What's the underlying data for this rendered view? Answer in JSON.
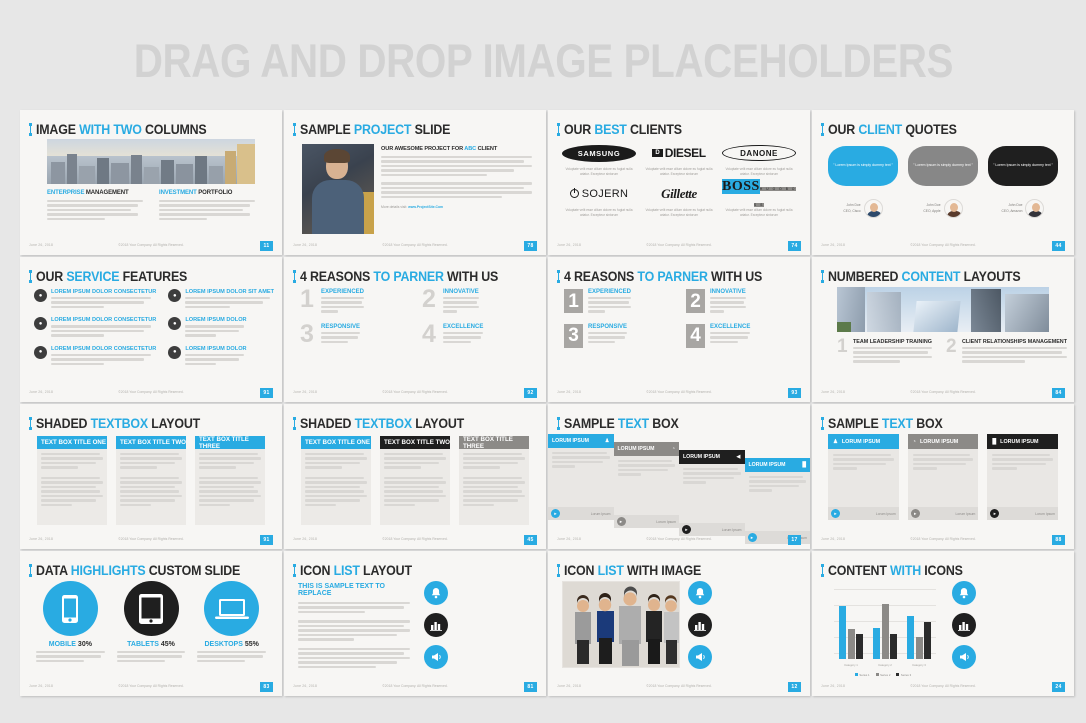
{
  "banner": {
    "title": "DRAG AND DROP IMAGE PLACEHOLDERS"
  },
  "common": {
    "date": "June 26, 2018",
    "copyright": "©2018 Your Company. All Rights Reserved.",
    "lorem_short": "Lorem ipsum dolor sit amet, consectetuer adipiscing elit, sed diam nonummy nibh euismod tincidunt ut laoreet dolore.",
    "lorem_long": "There are many variations of passages of Lorem Ipsum available, but the majority have suffered alteration.",
    "client_caption": "Voluptate velit esse cillum dolore eu fugiat nulla ariatur. Excepteur sintorum"
  },
  "slides": [
    {
      "num": "11",
      "title": {
        "pre": "IMAGE ",
        "hl": "WITH TWO",
        "post": " COLUMNS"
      },
      "columns": [
        {
          "head_hl": "ENTERPRISE",
          "head_rest": " MANAGEMENT",
          "body": "Lorem ipsum dolor sit amet, consectetuer adipiscing elit, sed dia nonummy nibh euismod tincidunt ut laoreet dolore. Rhoncus ut, imperdiet a, venenatis vitae. There are many variations of passages of Lorem Ipsum available, but the majority have suffered alteration."
        },
        {
          "head_hl": "INVESTMENT",
          "head_rest": " PORTFOLIO",
          "body": "Lorem ipsum dolor sit amet, consectetuer adipiscing elit, sed dia nonummy nibh euismod tincidunt ut laoreet dolore. Rhoncus ut, imperdiet a, venenatis vitae. There are many variations of passages of Lorem Ipsum available, but the majority have suffered alteration."
        }
      ],
      "image_alt": "cityscape-photo"
    },
    {
      "num": "78",
      "title": {
        "pre": "SAMPLE ",
        "hl": "PROJECT",
        "post": " SLIDE"
      },
      "heading_pre": "OUR AWESOME PROJECT FOR ",
      "heading_hl": "ABC",
      "heading_post": " CLIENT",
      "para1": "Lorem ipsum dolor sit amet, consectetuer adipiscing elit. Aenean commodo ligula eget dolor. Aenean massa. Cum sociis natoque penatibus. Ultricies pellentesque eu, pretium quis, sem. Nulla consequat massa quis enim. Donec pede justo, fringilla vel, aliquet nec, vulputate eget, arcu. In enim justo, Rhoncus ut, imperdiet a, venenatis vitae, justo.",
      "para2": "Nullam dictum felis eu pede mollis pretium Lorem ipsum dolor sit amet, consectetuer adipiscing elit, sed dia nonummy nibh euismod tincidunt ut laoreet dolore. Rhoncus ut, imperdiet a, venenatis vitae. There are many variations of passages of Lorem Ipsum available, but the majority have suffered alteration.",
      "more_label": "More details visit: ",
      "more_link": "www.ProjectSite.Com",
      "image_alt": "man-portrait-photo"
    },
    {
      "num": "74",
      "title": {
        "pre": "OUR ",
        "hl": "BEST",
        "post": " CLIENTS"
      },
      "clients": [
        {
          "name": "SAMSUNG",
          "style": "samsung"
        },
        {
          "name": "DIESEL",
          "style": "diesel"
        },
        {
          "name": "DANONE",
          "style": "danone"
        },
        {
          "name": "SOJERN",
          "style": "sojern"
        },
        {
          "name": "Gillette",
          "style": "gillette"
        },
        {
          "name": "BOSS",
          "sub": "H U G O  B O S S",
          "style": "boss"
        }
      ]
    },
    {
      "num": "44",
      "title": {
        "pre": "OUR ",
        "hl": "CLIENT",
        "post": " QUOTES"
      },
      "quotes": [
        {
          "text": "\" Lorem Ipsum is simply dummy text \"",
          "color": "blue",
          "name": "John Doe",
          "role": "CEO, Cisco"
        },
        {
          "text": "\" Lorem Ipsum is simply dummy text \"",
          "color": "gray",
          "name": "John Doe",
          "role": "CEO, Apple"
        },
        {
          "text": "\" Lorem Ipsum is simply dummy text \"",
          "color": "dark",
          "name": "John Doe",
          "role": "CEO, Amazon"
        }
      ]
    },
    {
      "num": "91",
      "title": {
        "pre": "OUR ",
        "hl": "SERVICE",
        "post": " FEATURES"
      },
      "features": [
        {
          "head": "LOREM IPSUM DOLOR CONSECTETUR",
          "icon": "chat-icon",
          "glyph": "✉",
          "body": "Sed do eiusmod tempor incididunt ut labore dolore magna aliqua. Ut enimue ad minim veniam, quis nostrud exercitation."
        },
        {
          "head": "LOREM IPSUM DOLOR SIT AMET",
          "icon": "mail-icon",
          "glyph": "✉",
          "body": "Sed do eiusmod tempor incididunt ut labore dolore magna aliqua. Ut enimue ad minim veniam, quis nostrud exercitation."
        },
        {
          "head": "LOREM IPSUM DOLOR CONSECTETUR",
          "icon": "phone-icon",
          "glyph": "☎",
          "body": "Sed do eiusmod tempor incididunt ut labore dolore magna aliqua. Ut enimue ad minim veniam, quis nostrud exercitation."
        },
        {
          "head": "LOREM IPSUM DOLOR",
          "icon": "pencil-icon",
          "glyph": "✎",
          "body": "Sed do eiusmod tempor incididunt ut labore dolore magna aliqua. Ut enimue ad minim veniam, quis nostrud exercitation."
        },
        {
          "head": "LOREM IPSUM DOLOR CONSECTETUR",
          "icon": "heart-icon",
          "glyph": "♥",
          "body": "Sed do eiusmod tempor incididunt ut labore dolore magna aliqua. Ut enimue ad minim veniam, quis nostrud exercitation."
        },
        {
          "head": "LOREM IPSUM DOLOR",
          "icon": "pencil-icon",
          "glyph": "✎",
          "body": "Sed do eiusmod tempor incididunt ut labore dolore magna aliqua. Ut enimue ad minim veniam, quis nostrud exercitation."
        }
      ]
    },
    {
      "num": "92",
      "title": {
        "pre": "4 REASONS ",
        "hl": "TO PARNER",
        "post": " WITH US"
      },
      "reasons": [
        {
          "n": "1",
          "head": "EXPERIENCED",
          "body": "There are many variations of passages of Lorem Ipsum available, but the majority have suffered alteration in some form, by injected humour, or randomised words which don't look even slightly believable."
        },
        {
          "n": "2",
          "head": "INNOVATIVE",
          "body": "There are many variations of passages of Lorem Ipsum available, but the majority have suffered alteration in some form, by injected humour, or randomised words which don't look even slightly believable."
        },
        {
          "n": "3",
          "head": "RESPONSIVE",
          "body": "There are many variations of passages of Lorem Ipsum available, but the majority have suffered alteration in some form, by injected humour, or randomised words."
        },
        {
          "n": "4",
          "head": "EXCELLENCE",
          "body": "There are many variations of passages of Lorem Ipsum available, but the majority have suffered alteration in some form, by injected humour, or randomised words."
        }
      ]
    },
    {
      "num": "93",
      "title": {
        "pre": "4 REASONS ",
        "hl": "TO PARNER",
        "post": " WITH US"
      },
      "reasons": [
        {
          "n": "1",
          "head": "EXPERIENCED",
          "body": "There are many variations of passages of Lorem Ipsum available, but the majority have suffered alteration in some form, by injected humour, or randomised words which don't look even slightly believable."
        },
        {
          "n": "2",
          "head": "INNOVATIVE",
          "body": "There are many variations of passages of Lorem Ipsum available, but the majority have suffered alteration in some form, by injected humour, or randomised words which don't look even slightly believable."
        },
        {
          "n": "3",
          "head": "RESPONSIVE",
          "body": "There are many variations of passages of Lorem Ipsum available, but the majority have suffered alteration in some form, by injected humour, or randomised words which."
        },
        {
          "n": "4",
          "head": "EXCELLENCE",
          "body": "There are many variations of passages of Lorem Ipsum available, but the majority have suffered alteration in some form, by injected humour, or randomised words which."
        }
      ]
    },
    {
      "num": "84",
      "title": {
        "pre": "NUMBERED ",
        "hl": "CONTENT",
        "post": " LAYOUTS"
      },
      "image_alt": "skyscrapers-photo",
      "items": [
        {
          "n": "1",
          "head": "TEAM LEADERSHIP TRAINING",
          "body": "Lorem ipsum dolor sit amet, consectetuer adipiscing elit, sed dia nonummy lorum nibh euismod tincidunt ut laoreet dolore magn. There are many variations of passages."
        },
        {
          "n": "2",
          "head": "CLIENT RELATIONSHIPS MANAGEMENT",
          "body": "Lorem ipsum dolor sit amet, consectetuer adipiscing elit, sed dia nonummy lorum nibh euismod tincidunt ut laoreet dolore magn. There are many variations of passages."
        }
      ]
    },
    {
      "num": "91",
      "title": {
        "pre": "SHADED ",
        "hl": "TEXTBOX",
        "post": " LAYOUT"
      },
      "boxes": [
        {
          "head": "TEXT BOX TITLE ONE",
          "color": "blue",
          "p1": "Lorem ipsum dolor sit amep consectetuer adipiscing elit and diam nonummy lorum nibher consectetuer adipiscing",
          "p2": "Lorem ipsum dolor sit amep consectetuer adipiscing elit sed diam nonummy lorum ipsum ober consectetuer adipiscing . There are many variations of passages of Lorem Ipsum available, but the majority have suffered"
        },
        {
          "head": "TEXT BOX TITLE TWO",
          "color": "blue",
          "p1": "Lorem ipsum dolor sit amep consectetuer adipiscing elit and diam nonummy lorum nibher consectetuer adipiscing",
          "p2": "Lorem ipsum dolor sit amep consectetuer adipiscing elit sed diam nonummy lorum ipsum ober consectetuer adipiscing . There are many variations of passages of Lorem Ipsum available, but the majority have suffered"
        },
        {
          "head": "TEXT BOX TITLE THREE",
          "color": "blue",
          "p1": "Lorem ipsum dolor sit amep consectetuer adipiscing elit and diam nonummy lorum nibher consectetuer adipiscing",
          "p2": "Lorem ipsum dolor sit amep consectetuer adipiscing elit sed diam nonummy lorum ipsum ober consectetuer adipiscing . There are many variations of passages of Lorem Ipsum available, but the majority have suffered"
        }
      ]
    },
    {
      "num": "45",
      "title": {
        "pre": "SHADED ",
        "hl": "TEXTBOX",
        "post": " LAYOUT"
      },
      "boxes": [
        {
          "head": "TEXT BOX TITLE ONE",
          "color": "blue",
          "p1": "Lorem ipsum dolor sit amep consectetuer adipiscing elit sed diam nonummy lorum nibher consectetuer adipiscing",
          "p2": "Lorem ipsum dolor sit amep consectetuer adipiscing elit sed diam nonummy lorum ipsum ober consectetuer adipiscing . There are many variations of passages of Lorem Ipsum available, but the majority have suffered."
        },
        {
          "head": "TEXT BOX TITLE TWO",
          "color": "dark",
          "p1": "Lorem ipsum dolor sit amep consectetuer adipiscing elit sed diam nonummy lorum nibher consectetuer adipiscing",
          "p2": "Lorem ipsum dolor sit amep consectetuer adipiscing elit sed diam nonummy lorum ipsum ober consectetuer adipiscing . There are many variations of passages of Lorem Ipsum available, but the majority have suffered."
        },
        {
          "head": "TEXT BOX TITLE THREE",
          "color": "gray",
          "p1": "Lorem ipsum dolor sit amep consectetuer adipiscing elit sed diam nonummy lorum nibher consectetuer adipiscing",
          "p2": "Lorem ipsum dolor sit amep consectetuer adipiscing elit sed diam nonummy lorum ipsum ober consectetuer adipiscing . There are many variations of passages of Lorem Ipsum available, but the majority have suffered."
        }
      ]
    },
    {
      "num": "17",
      "title": {
        "pre": "SAMPLE ",
        "hl": "TEXT",
        "post": " BOX"
      },
      "cards": [
        {
          "head": "LORUM IPSUM",
          "color": "blue",
          "icon": "person-icon",
          "glyph": "♟",
          "body": "Lorem ipsum is simply dummy text sample Lorem Ipsum is simply dummy text sample Lorem I",
          "footer": "Lorum Ipsum"
        },
        {
          "head": "LORUM IPSUM",
          "color": "gray",
          "icon": "pie-chart-icon",
          "glyph": "◔",
          "body": "Lorem ipsum is simply dummy text sample Lorem Ipsum is simply dummy text sample Lorem I",
          "footer": "Lorum Ipsum"
        },
        {
          "head": "LORUM IPSUM",
          "color": "dark",
          "icon": "megaphone-icon",
          "glyph": "◀",
          "body": "Lorem ipsum is simply dummy text sample Lorem Ipsum is simply dummy text sample Lorem I",
          "footer": "Lorum Ipsum"
        },
        {
          "head": "LORUM IPSUM",
          "color": "blue",
          "icon": "bar-chart-icon",
          "glyph": "█",
          "body": "Lorem ipsum is simply dummy text sample Lorem Ipsum is simply dummy text sample Lorem I",
          "footer": "Lorum Ipsum"
        }
      ]
    },
    {
      "num": "88",
      "title": {
        "pre": "SAMPLE ",
        "hl": "TEXT",
        "post": " BOX"
      },
      "cards": [
        {
          "head": "LORUM IPSUM",
          "color": "blue",
          "icon": "person-icon",
          "glyph": "♟",
          "body": "Lorem ipsum is simply dummy text sample Lorem Ipsum is simply dummy text sample Lorem I",
          "footer": "Lorum Ipsum"
        },
        {
          "head": "LORUM IPSUM",
          "color": "gray",
          "icon": "pie-chart-icon",
          "glyph": "◔",
          "body": "Lorem ipsum is simply dummy text sample Lorem Ipsum is simply dummy text sample Lorem I",
          "footer": "Lorum Ipsum"
        },
        {
          "head": "LORUM IPSUM",
          "color": "dark",
          "icon": "bar-chart-icon",
          "glyph": "█",
          "body": "Lorem ipsum is simply dummy text sample Lorem Ipsum is simply dummy text sample Lorem I",
          "footer": "Lorum Ipsum"
        }
      ]
    },
    {
      "num": "83",
      "title": {
        "pre": "DATA ",
        "hl": "HIGHLIGHTS",
        "post": " CUSTOM SLIDE"
      },
      "stats": [
        {
          "label": "MOBILE",
          "value": "30%",
          "color": "blue",
          "icon": "smartphone-icon",
          "body": "There are many variations of Lorem Ipsum available on, but the majority have suffered alteration."
        },
        {
          "label": "TABLETS",
          "value": "45%",
          "color": "dark",
          "icon": "tablet-icon",
          "body": "There are many variations of Lorem Ipsum available on, but the majority have suffered alteration."
        },
        {
          "label": "DESKTOPS",
          "value": "55%",
          "color": "blue",
          "icon": "laptop-icon",
          "body": "There are many variations of Lorem Ipsum available on, but the majority have suffered alteration."
        }
      ]
    },
    {
      "num": "81",
      "title": {
        "pre": "ICON ",
        "hl": "LIST",
        "post": " LAYOUT"
      },
      "left_head": "THIS IS SAMPLE TEXT TO REPLACE",
      "left_paras": [
        "Lorem ipsum dolor sit amet, lorem ipsum dolor sit amet, consectetuer adipiscing elit, sed diam nonummy nibh euismod tincidun ut laoreet.",
        "Dolore magna aliquam aliquam erat volutpat. Ut wisi enim ad minim veniam, quis nostrud exerci tation ullamcorper suscipit lobortis nisl ut aliquip ex ea commodo consequat sample text there.",
        "There are many variations of passages of Lorem Ipsum available, but the majority have suffered alteration in some form, by injected humour, or randomised words which don't look even slightly believable."
      ],
      "items": [
        {
          "icon": "bell-icon",
          "color": "blue",
          "body": "There are many variations of passages of Lorem Ipsum available, but the majority have suffered alteration."
        },
        {
          "icon": "bar-chart-icon",
          "color": "dark",
          "body": "There are many variations of passages of Lorem Ipsum available, but the majority have suffered alteration."
        },
        {
          "icon": "megaphone-icon",
          "color": "blue",
          "body": "There are many variations of passages of Lorem Ipsum available, but the majority have suffered alteration."
        }
      ]
    },
    {
      "num": "12",
      "title": {
        "pre": "ICON ",
        "hl": "LIST",
        "post": " WITH IMAGE"
      },
      "image_alt": "business-team-photo",
      "items": [
        {
          "icon": "bell-icon",
          "color": "blue",
          "body": "There are many variations of passages of Lorem Ipsum available, but the majority have suffered alteration."
        },
        {
          "icon": "bar-chart-icon",
          "color": "dark",
          "body": "There are many variations of passages of Lorem Ipsum available, but the majority have suffered alteration."
        },
        {
          "icon": "megaphone-icon",
          "color": "blue",
          "body": "There are many variations of passages of Lorem Ipsum available, but the majority have suffered alteration."
        }
      ]
    },
    {
      "num": "24",
      "title": {
        "pre": "CONTENT ",
        "hl": "WITH",
        "post": " ICONS"
      },
      "items": [
        {
          "icon": "bell-icon",
          "color": "blue",
          "body": "There are many variations of passages of Lorem Ipsum available, but the majority have suffered alteration."
        },
        {
          "icon": "bar-chart-icon",
          "color": "dark",
          "body": "There are many variations of passages of Lorem Ipsum available, but the majority have suffered alteration."
        },
        {
          "icon": "megaphone-icon",
          "color": "blue",
          "body": "There are many variations of passages of Lorem Ipsum available, but the majority have suffered alteration."
        }
      ]
    }
  ],
  "chart_data": {
    "type": "bar",
    "title": "",
    "categories": [
      "Category 1",
      "Category 2",
      "Category 3"
    ],
    "series": [
      {
        "name": "Series 1",
        "color": "#29abe2",
        "values": [
          4.3,
          2.5,
          3.5
        ]
      },
      {
        "name": "Series 2",
        "color": "#8c8a87",
        "values": [
          2.4,
          4.4,
          1.8
        ]
      },
      {
        "name": "Series 3",
        "color": "#2b2b2b",
        "values": [
          2.0,
          2.0,
          3.0
        ]
      }
    ],
    "xlabel": "",
    "ylabel": "",
    "ylim": [
      0,
      5
    ],
    "grid": true,
    "legend_position": "bottom"
  },
  "colors": {
    "accent": "#29abe2",
    "dark": "#1f1f1f",
    "gray": "#8c8a87",
    "slide_bg": "#f7f6f4",
    "page_bg": "#e7e7e7",
    "banner_text": "#d2d2d2"
  }
}
